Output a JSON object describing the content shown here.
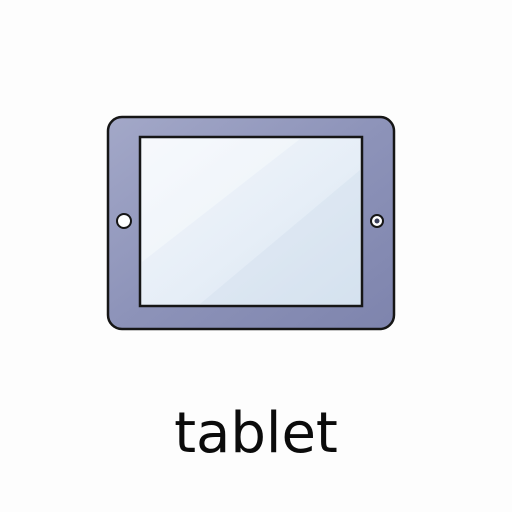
{
  "caption": "tablet",
  "icon": {
    "name": "tablet-icon",
    "colors": {
      "frame": "#8b91b8",
      "frame_highlight": "#a9aece",
      "outline": "#1a1a1a",
      "screen_top": "#f3f7fc",
      "screen_bottom": "#dbe7f3",
      "background": "#fdfdfd"
    }
  }
}
